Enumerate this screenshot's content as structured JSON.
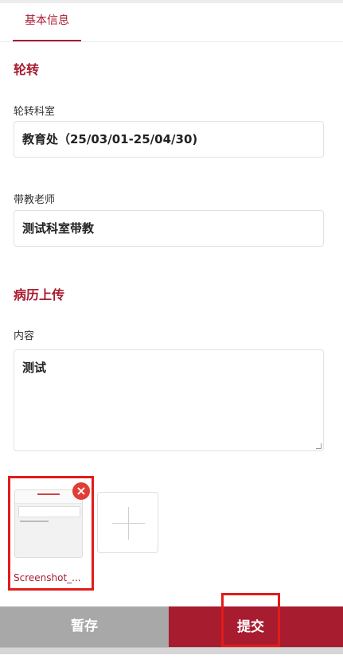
{
  "tabs": [
    {
      "label": "基本信息",
      "active": true
    }
  ],
  "rotation_section": {
    "title": "轮转",
    "department_label": "轮转科室",
    "department_value": "教育处（25/03/01-25/04/30)",
    "teacher_label": "带教老师",
    "teacher_value": "测试科室带教"
  },
  "upload_section": {
    "title": "病历上传",
    "content_label": "内容",
    "content_value": "测试",
    "attachments": [
      {
        "file_name": "Screenshot_..."
      }
    ]
  },
  "footer": {
    "save_label": "暂存",
    "submit_label": "提交"
  },
  "colors": {
    "accent": "#a81c30",
    "highlight_box": "#e31b1b",
    "save_button": "#a8a8a8"
  }
}
